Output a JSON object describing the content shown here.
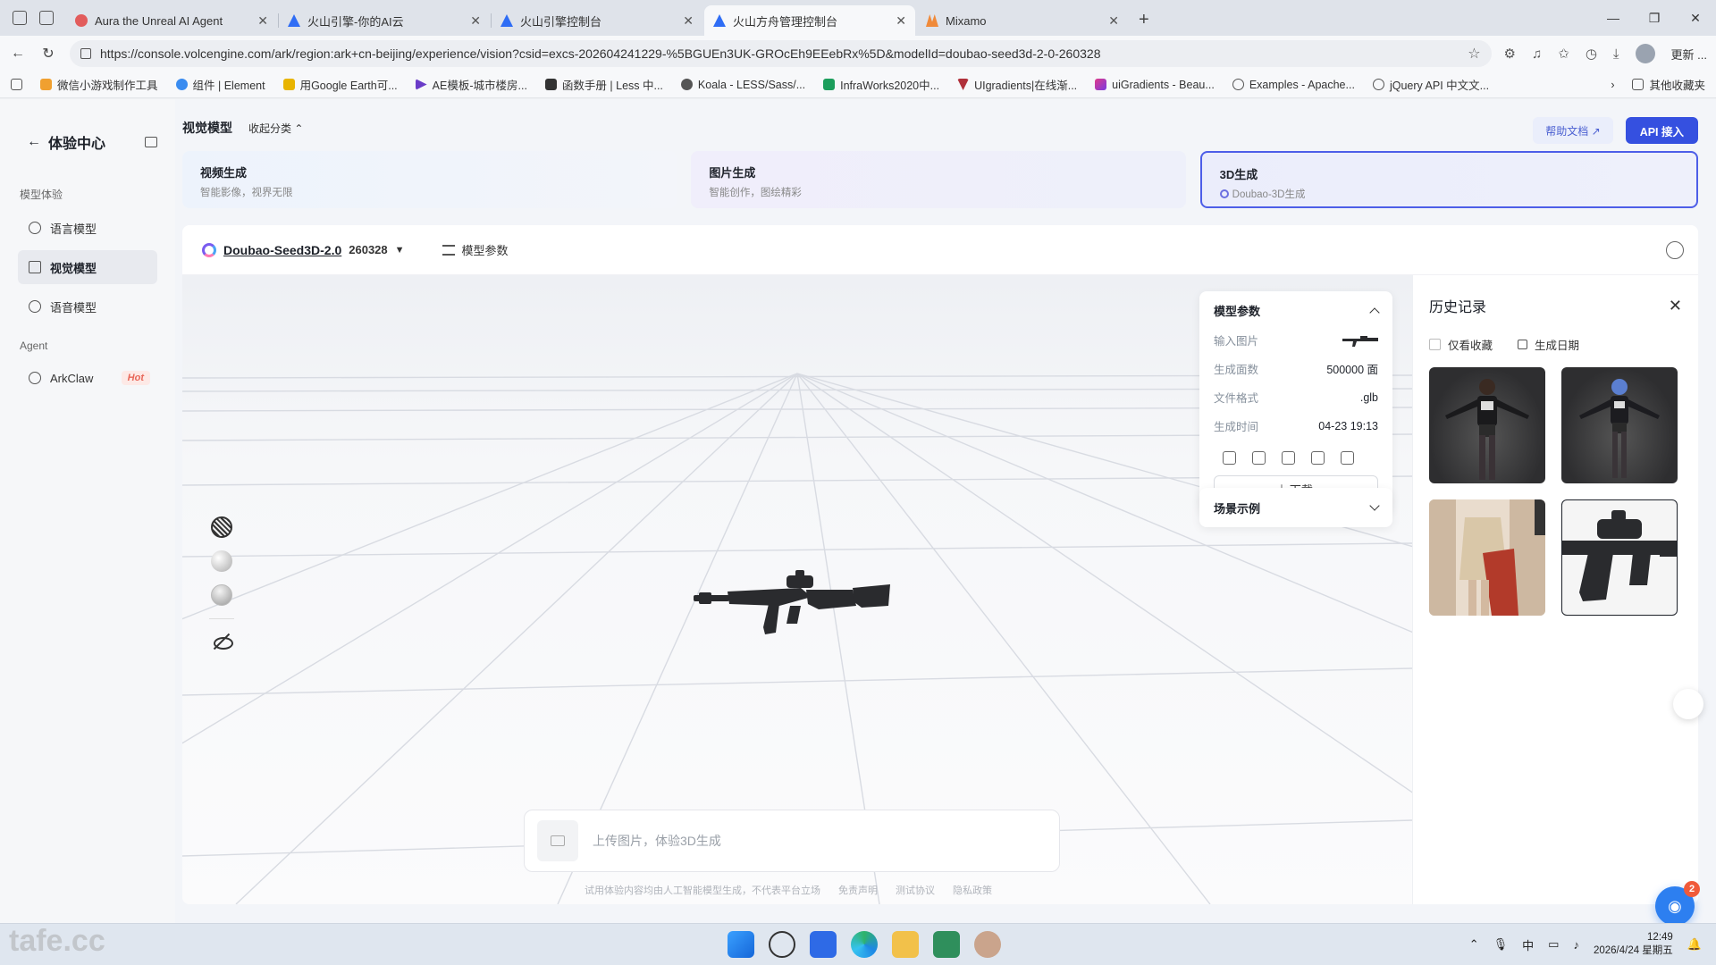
{
  "browser": {
    "tabs": [
      {
        "title": "Aura the Unreal AI Agent",
        "favicon_color": "#e25c5c"
      },
      {
        "title": "火山引擎-你的AI云",
        "favicon_color": "#2f6df5"
      },
      {
        "title": "火山引擎控制台",
        "favicon_color": "#2f6df5"
      },
      {
        "title": "火山方舟管理控制台",
        "favicon_color": "#2f6df5"
      },
      {
        "title": "Mixamo",
        "favicon_color": "#f08a3a"
      }
    ],
    "url": "https://console.volcengine.com/ark/region:ark+cn-beijing/experience/vision?csid=excs-202604241229-%5BGUEn3UK-GROcEh9EEebRx%5D&modelId=doubao-seed3d-2-0-260328",
    "update_label": "更新 ...",
    "bookmarks": [
      "微信小游戏制作工具",
      "组件 | Element",
      "用Google Earth可...",
      "AE模板-城市楼房...",
      "函数手册 | Less 中...",
      "Koala - LESS/Sass/...",
      "InfraWorks2020中...",
      "UIgradients|在线渐...",
      "uiGradients - Beau...",
      "Examples - Apache...",
      "jQuery API 中文文..."
    ],
    "other_bookmarks": "其他收藏夹"
  },
  "sidebar": {
    "title": "体验中心",
    "section_models": "模型体验",
    "items": [
      {
        "label": "语言模型"
      },
      {
        "label": "视觉模型"
      },
      {
        "label": "语音模型"
      }
    ],
    "section_agent": "Agent",
    "agent_item": {
      "label": "ArkClaw",
      "badge": "Hot"
    }
  },
  "header": {
    "title": "视觉模型",
    "collapse_label": "收起分类 ⌃",
    "help_label": "帮助文档 ↗",
    "api_label": "API 接入"
  },
  "categories": [
    {
      "title": "视频生成",
      "subtitle": "智能影像，视界无限"
    },
    {
      "title": "图片生成",
      "subtitle": "智能创作，图绘精彩"
    },
    {
      "title": "3D生成",
      "subtitle": "Doubao-3D生成"
    }
  ],
  "workspace": {
    "model_name": "Doubao-Seed3D-2.0",
    "model_version": "260328",
    "params_label": "模型参数",
    "prompt_placeholder": "上传图片，体验3D生成",
    "footer": [
      "试用体验内容均由人工智能模型生成，不代表平台立场",
      "免责声明",
      "测试协议",
      "隐私政策"
    ]
  },
  "param_panel": {
    "title": "模型参数",
    "rows": [
      {
        "key": "输入图片",
        "value": ""
      },
      {
        "key": "生成面数",
        "value": "500000 面"
      },
      {
        "key": "文件格式",
        "value": ".glb"
      },
      {
        "key": "生成时间",
        "value": "04-23 19:13"
      }
    ],
    "download_label": "下载",
    "scene_label": "场景示例"
  },
  "history": {
    "title": "历史记录",
    "filter_favorites": "仅看收藏",
    "filter_date": "生成日期",
    "thumb_count_note": "",
    "notification_count": "2"
  },
  "taskbar": {
    "ime": "中",
    "time": "12:49",
    "date": "2026/4/24 星期五"
  },
  "watermark": "tafe.cc"
}
